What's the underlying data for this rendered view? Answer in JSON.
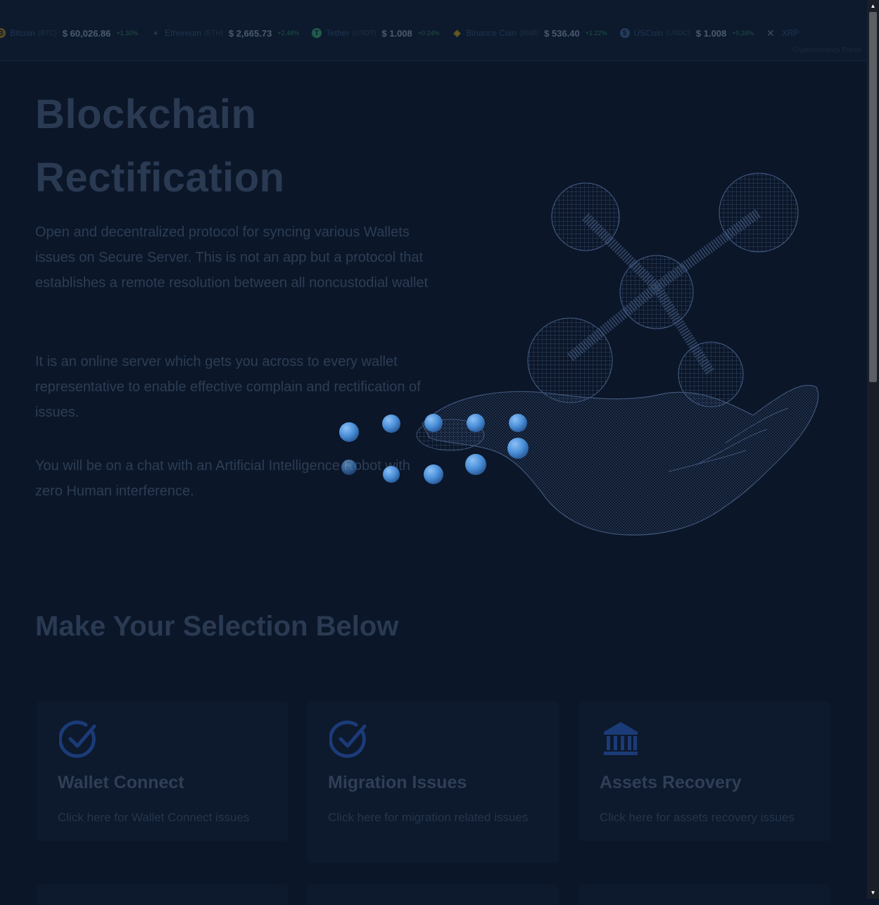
{
  "ticker": {
    "coins": [
      {
        "name": "Bitcoin",
        "symbol": "(BTC)",
        "price": "$ 60,026.86",
        "change": "+1.30%",
        "icon": "bitcoin-icon",
        "color": "#6b5a2a"
      },
      {
        "name": "Ethereum",
        "symbol": "(ETH)",
        "price": "$ 2,665.73",
        "change": "+2.48%",
        "icon": "ethereum-icon",
        "color": "#2d3a52"
      },
      {
        "name": "Tether",
        "symbol": "(USDT)",
        "price": "$ 1.008",
        "change": "+0.24%",
        "icon": "tether-icon",
        "color": "#1f5a4a"
      },
      {
        "name": "Binance Coin",
        "symbol": "(BNB)",
        "price": "$ 536.40",
        "change": "+1.22%",
        "icon": "binance-icon",
        "color": "#6b5a20"
      },
      {
        "name": "USCoin",
        "symbol": "(USDC)",
        "price": "$ 1.008",
        "change": "+0.24%",
        "icon": "usdc-icon",
        "color": "#243a5a"
      }
    ],
    "close_glyph": "✕",
    "next_coin": "XRP",
    "caption": "Cryptocurrency Prices"
  },
  "hero": {
    "title_line1": "Blockchain",
    "title_line2": "Rectification",
    "para1": "Open and decentralized protocol for syncing various Wallets issues on Secure Server. This is not an app but a protocol that establishes a remote resolution between all noncustodial wallet",
    "para2": "It is an online server which gets you across to every wallet representative to enable effective complain and rectification of issues.",
    "para3": "You will be on a chat with an Artificial Intelligence Robot with zero Human interference."
  },
  "selection": {
    "title": "Make Your Selection Below",
    "cards": [
      {
        "title": "Wallet Connect",
        "desc": "Click here for Wallet Connect issues",
        "icon": "check-circle-icon"
      },
      {
        "title": "Migration Issues",
        "desc": "Click here for migration related issues",
        "icon": "check-circle-icon"
      },
      {
        "title": "Assets Recovery",
        "desc": "Click here for assets recovery issues",
        "icon": "bank-icon"
      }
    ]
  },
  "colors": {
    "background": "#0b1628",
    "accent": "#1b3b78",
    "loader_dot": "#4a8fd8"
  }
}
